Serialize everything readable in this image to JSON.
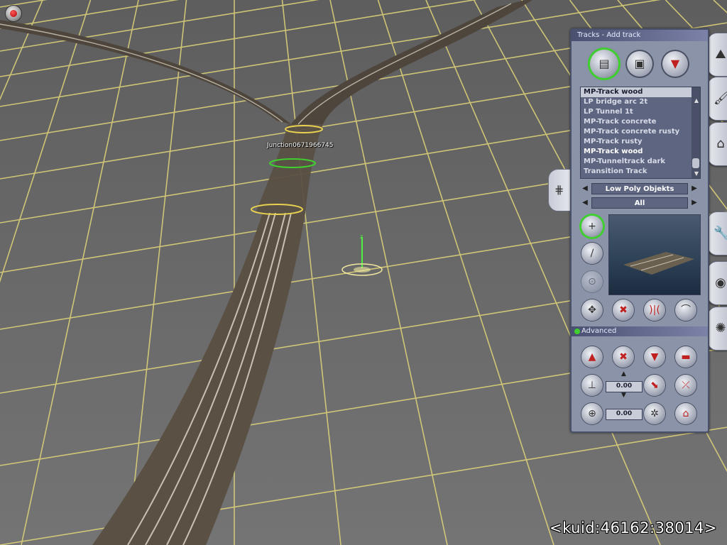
{
  "viewport": {
    "junction_label": "Junction0671966745",
    "kuid_label": "<kuid:46162:38014>"
  },
  "panel": {
    "title": "Tracks - Add track",
    "mode_buttons": [
      {
        "icon": "track-icon",
        "active": true
      },
      {
        "icon": "track-object-icon",
        "active": false
      },
      {
        "icon": "trackmark-icon",
        "active": false
      }
    ],
    "asset_list": {
      "selected": "MP-Track wood",
      "items": [
        "LP bridge arc 2t",
        "LP Tunnel 1t",
        "MP-Track concrete",
        "MP-Track concrete rusty",
        "MP-Track rusty",
        "MP-Track wood",
        "MP-Tunneltrack dark",
        "Transition Track"
      ]
    },
    "filter_region": "Low Poly Objekts",
    "filter_category": "All",
    "advanced_label": "Advanced",
    "height_value": "0.00",
    "angle_value": "0.00"
  },
  "colors": {
    "ground": "#6a6a6a",
    "grid": "#e8d870",
    "panel": "#8a93a8",
    "accent_green": "#3fcf2f"
  }
}
